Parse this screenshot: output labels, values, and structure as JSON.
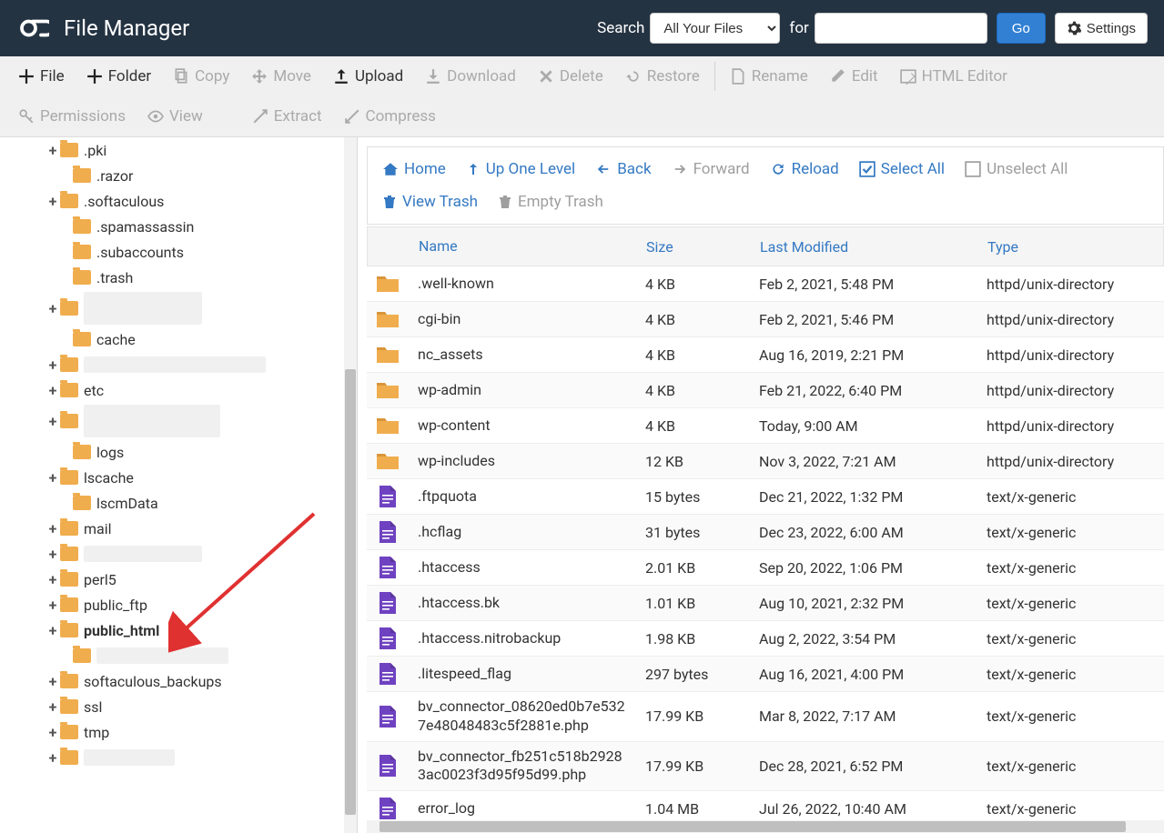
{
  "header": {
    "title": "File Manager",
    "search_label": "Search",
    "search_scope": "All Your Files",
    "for_label": "for",
    "go": "Go",
    "settings": "Settings"
  },
  "toolbar": {
    "file": "File",
    "folder": "Folder",
    "copy": "Copy",
    "move": "Move",
    "upload": "Upload",
    "download": "Download",
    "delete": "Delete",
    "restore": "Restore",
    "rename": "Rename",
    "edit": "Edit",
    "html_editor": "HTML Editor",
    "permissions": "Permissions",
    "view": "View",
    "extract": "Extract",
    "compress": "Compress"
  },
  "actions": {
    "home": "Home",
    "up": "Up One Level",
    "back": "Back",
    "forward": "Forward",
    "reload": "Reload",
    "select_all": "Select All",
    "unselect_all": "Unselect All",
    "view_trash": "View Trash",
    "empty_trash": "Empty Trash"
  },
  "columns": {
    "name": "Name",
    "size": "Size",
    "last_modified": "Last Modified",
    "type": "Type"
  },
  "tree": [
    {
      "indent": 2,
      "plus": true,
      "label": ".pki",
      "redacted": false
    },
    {
      "indent": 3,
      "plus": false,
      "label": ".razor",
      "redacted": false
    },
    {
      "indent": 2,
      "plus": true,
      "label": ".softaculous",
      "redacted": false
    },
    {
      "indent": 3,
      "plus": false,
      "label": ".spamassassin",
      "redacted": false
    },
    {
      "indent": 3,
      "plus": false,
      "label": ".subaccounts",
      "redacted": false
    },
    {
      "indent": 3,
      "plus": false,
      "label": ".trash",
      "redacted": false
    },
    {
      "indent": 2,
      "plus": true,
      "label": "",
      "redacted": true,
      "rw": 130,
      "rh": 40
    },
    {
      "indent": 3,
      "plus": false,
      "label": "cache",
      "redacted": false
    },
    {
      "indent": 2,
      "plus": true,
      "label": "",
      "redacted": true,
      "rw": 200
    },
    {
      "indent": 2,
      "plus": true,
      "label": "etc",
      "redacted": false
    },
    {
      "indent": 2,
      "plus": true,
      "label": "",
      "redacted": true,
      "rw": 150,
      "rh": 40
    },
    {
      "indent": 3,
      "plus": false,
      "label": "logs",
      "redacted": false
    },
    {
      "indent": 2,
      "plus": true,
      "label": "lscache",
      "redacted": false
    },
    {
      "indent": 3,
      "plus": false,
      "label": "lscmData",
      "redacted": false
    },
    {
      "indent": 2,
      "plus": true,
      "label": "mail",
      "redacted": false
    },
    {
      "indent": 2,
      "plus": true,
      "label": "",
      "redacted": true,
      "rw": 130
    },
    {
      "indent": 2,
      "plus": true,
      "label": "perl5",
      "redacted": false
    },
    {
      "indent": 2,
      "plus": true,
      "label": "public_ftp",
      "redacted": false
    },
    {
      "indent": 2,
      "plus": true,
      "label": "public_html",
      "redacted": false,
      "bold": true
    },
    {
      "indent": 3,
      "plus": false,
      "label": "",
      "redacted": true,
      "rw": 145
    },
    {
      "indent": 2,
      "plus": true,
      "label": "softaculous_backups",
      "redacted": false
    },
    {
      "indent": 2,
      "plus": true,
      "label": "ssl",
      "redacted": false
    },
    {
      "indent": 2,
      "plus": true,
      "label": "tmp",
      "redacted": false
    },
    {
      "indent": 2,
      "plus": true,
      "label": "",
      "redacted": true,
      "rw": 100
    }
  ],
  "files": [
    {
      "icon": "folder",
      "name": ".well-known",
      "size": "4 KB",
      "mod": "Feb 2, 2021, 5:48 PM",
      "type": "httpd/unix-directory"
    },
    {
      "icon": "folder",
      "name": "cgi-bin",
      "size": "4 KB",
      "mod": "Feb 2, 2021, 5:46 PM",
      "type": "httpd/unix-directory"
    },
    {
      "icon": "folder",
      "name": "nc_assets",
      "size": "4 KB",
      "mod": "Aug 16, 2019, 2:21 PM",
      "type": "httpd/unix-directory"
    },
    {
      "icon": "folder",
      "name": "wp-admin",
      "size": "4 KB",
      "mod": "Feb 21, 2022, 6:40 PM",
      "type": "httpd/unix-directory"
    },
    {
      "icon": "folder",
      "name": "wp-content",
      "size": "4 KB",
      "mod": "Today, 9:00 AM",
      "type": "httpd/unix-directory"
    },
    {
      "icon": "folder",
      "name": "wp-includes",
      "size": "12 KB",
      "mod": "Nov 3, 2022, 7:21 AM",
      "type": "httpd/unix-directory"
    },
    {
      "icon": "file",
      "name": ".ftpquota",
      "size": "15 bytes",
      "mod": "Dec 21, 2022, 1:32 PM",
      "type": "text/x-generic"
    },
    {
      "icon": "file",
      "name": ".hcflag",
      "size": "31 bytes",
      "mod": "Dec 23, 2022, 6:00 AM",
      "type": "text/x-generic"
    },
    {
      "icon": "file",
      "name": ".htaccess",
      "size": "2.01 KB",
      "mod": "Sep 20, 2022, 1:06 PM",
      "type": "text/x-generic"
    },
    {
      "icon": "file",
      "name": ".htaccess.bk",
      "size": "1.01 KB",
      "mod": "Aug 10, 2021, 2:32 PM",
      "type": "text/x-generic"
    },
    {
      "icon": "file",
      "name": ".htaccess.nitrobackup",
      "size": "1.98 KB",
      "mod": "Aug 2, 2022, 3:54 PM",
      "type": "text/x-generic"
    },
    {
      "icon": "file",
      "name": ".litespeed_flag",
      "size": "297 bytes",
      "mod": "Aug 16, 2021, 4:00 PM",
      "type": "text/x-generic"
    },
    {
      "icon": "file",
      "name": "bv_connector_08620ed0b7e5327e48048483c5f2881e.php",
      "size": "17.99 KB",
      "mod": "Mar 8, 2022, 7:17 AM",
      "type": "text/x-generic"
    },
    {
      "icon": "file",
      "name": "bv_connector_fb251c518b29283ac0023f3d95f95d99.php",
      "size": "17.99 KB",
      "mod": "Dec 28, 2021, 6:52 PM",
      "type": "text/x-generic"
    },
    {
      "icon": "file",
      "name": "error_log",
      "size": "1.04 MB",
      "mod": "Jul 26, 2022, 10:40 AM",
      "type": "text/x-generic"
    }
  ]
}
